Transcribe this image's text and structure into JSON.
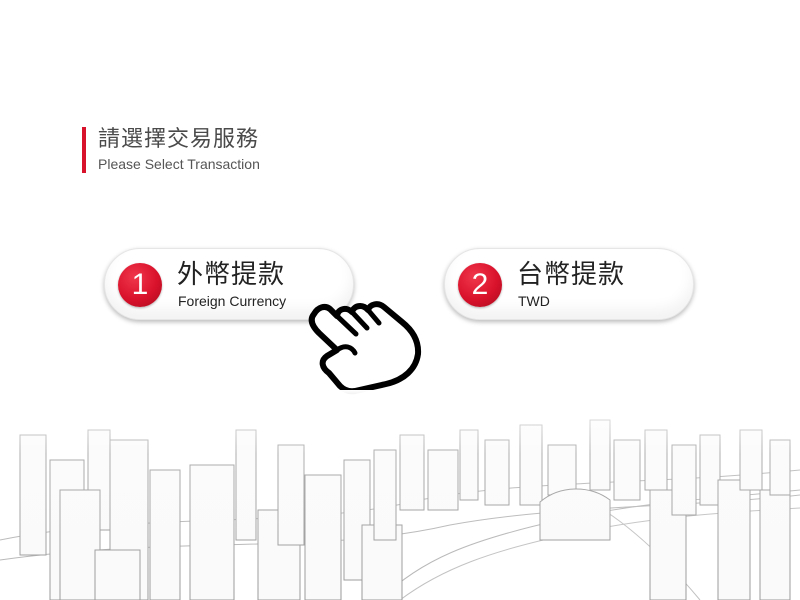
{
  "header": {
    "title_zh": "請選擇交易服務",
    "title_en": "Please Select Transaction",
    "accent_color": "#d9122b"
  },
  "options": [
    {
      "number": "1",
      "label_zh": "外幣提款",
      "label_en": "Foreign Currency"
    },
    {
      "number": "2",
      "label_zh": "台幣提款",
      "label_en": "TWD"
    }
  ],
  "icons": {
    "pointer": "pointing-hand-icon",
    "background": "city-skyline-illustration"
  }
}
